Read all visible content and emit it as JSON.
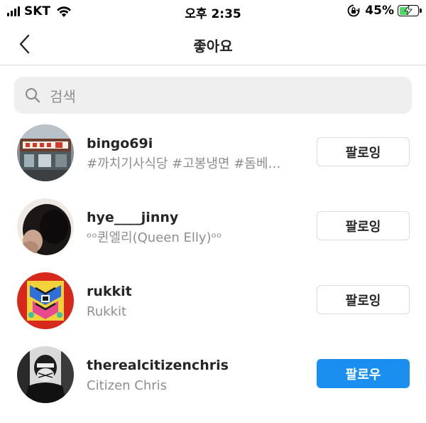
{
  "status_bar": {
    "carrier": "SKT",
    "time": "오후 2:35",
    "battery_percent": "45%",
    "battery_level": 0.45,
    "signal_icon": "cellular-signal-icon",
    "wifi_icon": "wifi-icon",
    "rotation_lock_icon": "rotation-lock-icon",
    "battery_icon": "battery-charging-icon",
    "battery_color": "#4cd964"
  },
  "header": {
    "title": "좋아요",
    "back_icon": "chevron-left-icon"
  },
  "search": {
    "placeholder": "검색",
    "icon": "search-icon"
  },
  "users": [
    {
      "username": "bingo69i",
      "subtitle": "#까치기사식당 #고봉냉면 #돔베…",
      "button_label": "팔로잉",
      "following": true
    },
    {
      "username": "hye____jinny",
      "subtitle": "ᵒᵒ퀸엘리(Queen Elly)ᵒᵒ",
      "button_label": "팔로잉",
      "following": true
    },
    {
      "username": "rukkit",
      "subtitle": "Rukkit",
      "button_label": "팔로잉",
      "following": true
    },
    {
      "username": "therealcitizenchris",
      "subtitle": "Citizen Chris",
      "button_label": "팔로우",
      "following": false
    }
  ],
  "colors": {
    "follow_blue": "#1a8ff0",
    "secondary_text": "#8e8e8e",
    "divider": "#dbdbdb"
  }
}
